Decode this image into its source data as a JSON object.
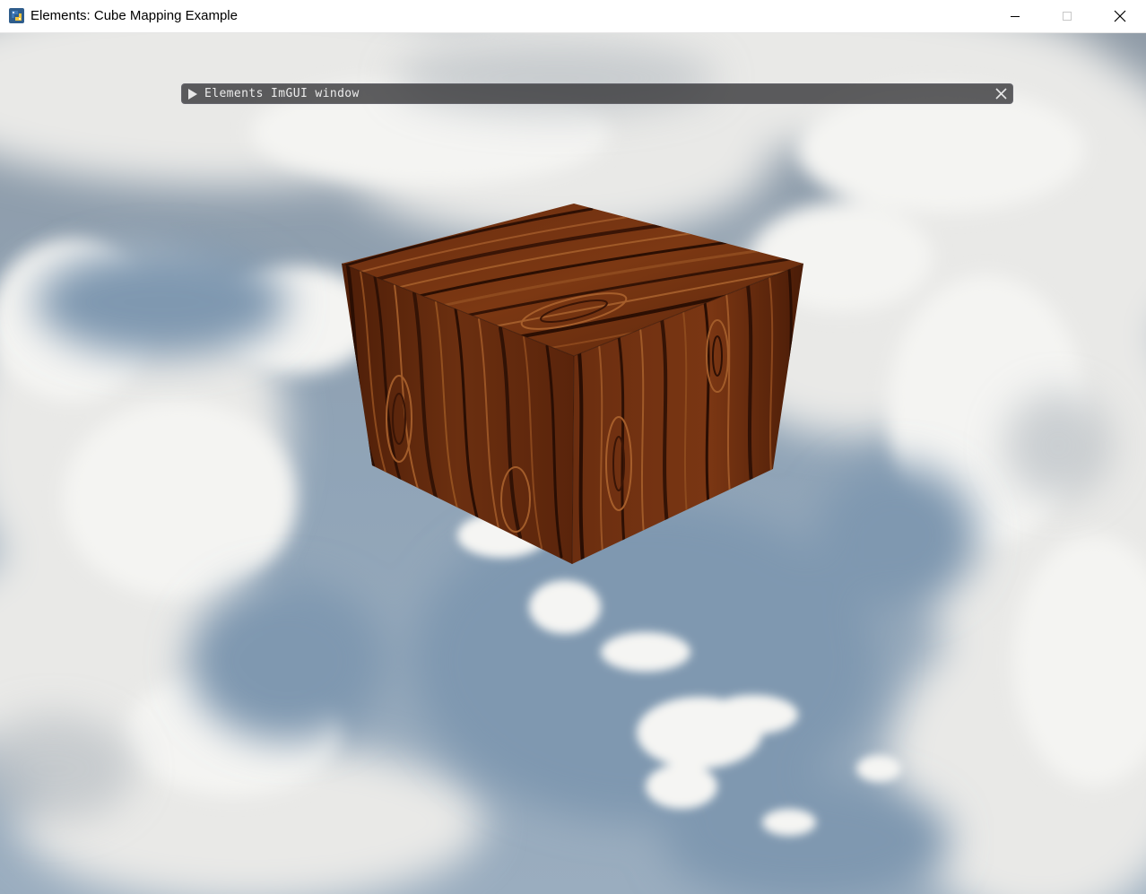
{
  "window": {
    "title": "Elements: Cube Mapping Example",
    "icon": "python-icon"
  },
  "caption_buttons": {
    "minimize": "minimize-icon",
    "maximize": "maximize-icon",
    "close": "close-icon"
  },
  "imgui": {
    "title": "Elements ImGUI window",
    "collapsed": true,
    "arrow_icon": "triangle-right-icon",
    "close_icon": "close-icon"
  },
  "scene": {
    "skybox": "cloudy-sky",
    "object": "wooden-cube",
    "colors": {
      "sky_blue": "#8fa3b5",
      "cloud_white": "#f2f2f0",
      "wood_dark": "#3a1606",
      "wood_mid": "#6b2e10",
      "wood_light": "#9a5424"
    }
  }
}
